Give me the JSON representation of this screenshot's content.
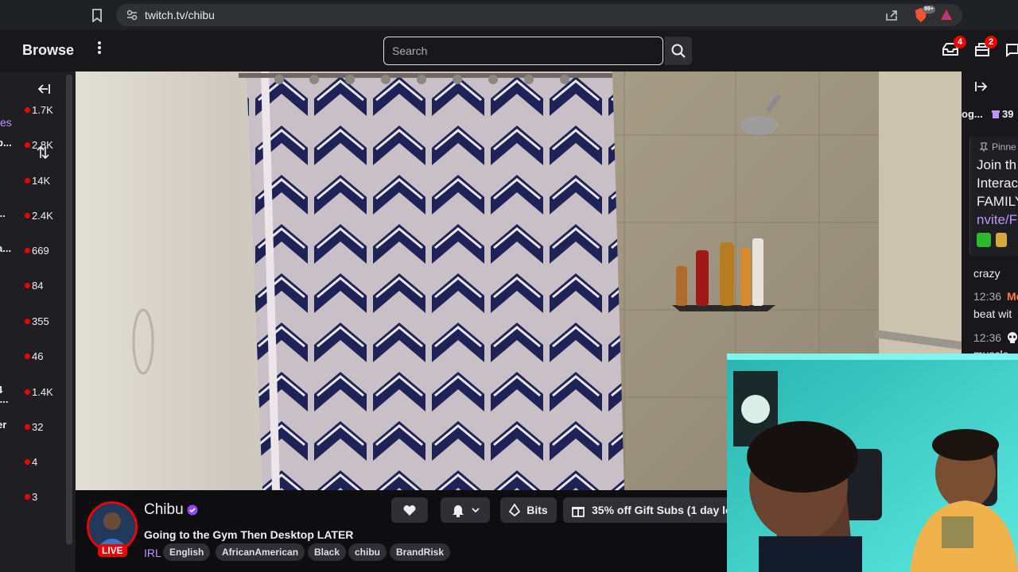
{
  "browser": {
    "url": "twitch.tv/chibu",
    "brave_badge": "99+"
  },
  "topnav": {
    "browse_label": "Browse",
    "search_placeholder": "Search",
    "inbox_count": "4",
    "notifications_count": "2"
  },
  "sidebar": {
    "partial_label": "es",
    "channels": [
      {
        "name": "",
        "viewers": "1.7K"
      },
      {
        "name": "b...",
        "viewers": "2.8K"
      },
      {
        "name": "",
        "viewers": "14K"
      },
      {
        "name": "...",
        "viewers": "2.4K"
      },
      {
        "name": "a...",
        "viewers": "669"
      },
      {
        "name": "",
        "viewers": "84"
      },
      {
        "name": "",
        "viewers": "355"
      },
      {
        "name": "",
        "viewers": "46"
      },
      {
        "name": "4\nl...",
        "viewers": "1.4K"
      },
      {
        "name": "er",
        "viewers": "32"
      },
      {
        "name": "",
        "viewers": "4"
      },
      {
        "name": "",
        "viewers": "3"
      }
    ]
  },
  "channel": {
    "name": "Chibu",
    "live_label": "LIVE",
    "title": "Going to the Gym Then Desktop LATER",
    "category": "IRL",
    "tags": [
      "English",
      "AfricanAmerican",
      "Black",
      "chibu",
      "BrandRisk"
    ],
    "bits_label": "Bits",
    "gift_label": "35% off Gift Subs (1 day le"
  },
  "chat": {
    "header_partial": "og...",
    "points_partial": "39",
    "pinned_label": "Pinne",
    "pinned_lines": [
      "Join th",
      "Interac",
      "FAMILY",
      "nvite/F"
    ],
    "messages": [
      {
        "time": "",
        "text": "crazy"
      },
      {
        "time": "12:36",
        "user": "Me",
        "text": "beat wit"
      },
      {
        "time": "12:36",
        "user": "",
        "text": "muscle"
      }
    ]
  },
  "colors": {
    "twitch_purple": "#9147ff",
    "live_red": "#eb0400",
    "link_purple": "#bf94ff"
  }
}
